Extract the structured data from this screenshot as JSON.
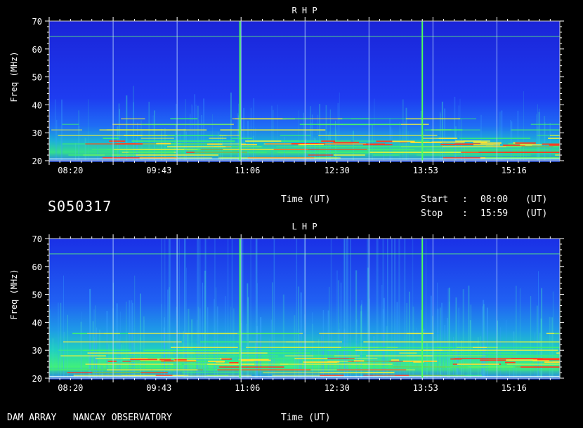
{
  "session_id": "S050317",
  "start_label": "Start",
  "stop_label": "Stop",
  "colon": ":",
  "start_time": "08:00",
  "stop_time": "15:59",
  "ut_unit": "(UT)",
  "footer_left": "DAM ARRAY   NANCAY OBSERVATORY",
  "colors": {
    "background": "#000000",
    "spectrogram_base": "#1a28e8",
    "grid_line": "#b8e0ff",
    "interference": "#4cff5c"
  },
  "chart_data": [
    {
      "type": "heatmap",
      "title": "R H P",
      "xlabel": "Time (UT)",
      "ylabel": "Freq (MHz)",
      "x_ticks": [
        "08:20",
        "09:43",
        "11:06",
        "12:30",
        "13:53",
        "15:16"
      ],
      "y_ticks": [
        20,
        30,
        40,
        50,
        60,
        70
      ],
      "ylim": [
        20,
        70
      ],
      "xlim": [
        "08:00",
        "15:59"
      ]
    },
    {
      "type": "heatmap",
      "title": "L H P",
      "xlabel": "Time (UT)",
      "ylabel": "Freq (MHz)",
      "x_ticks": [
        "08:20",
        "09:43",
        "11:06",
        "12:30",
        "13:53",
        "15:16"
      ],
      "y_ticks": [
        20,
        30,
        40,
        50,
        60,
        70
      ],
      "ylim": [
        20,
        70
      ],
      "xlim": [
        "08:00",
        "15:59"
      ]
    }
  ]
}
